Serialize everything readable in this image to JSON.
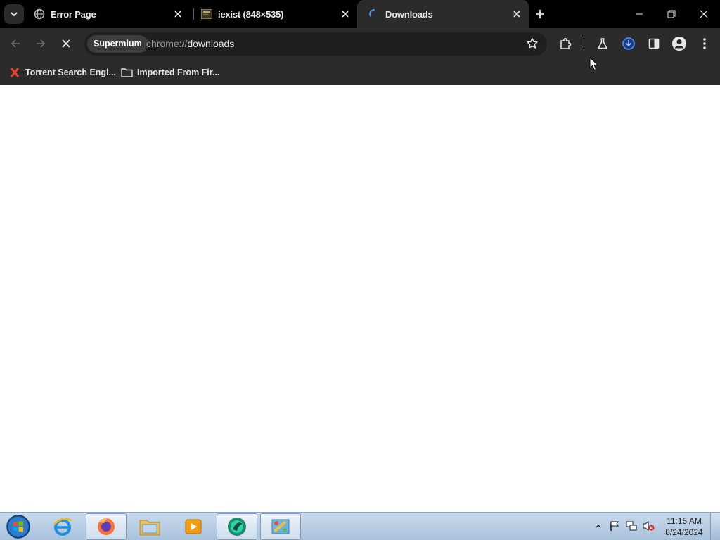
{
  "browser": {
    "tabs": [
      {
        "title": "Error Page",
        "icon": "globe-icon",
        "active": false
      },
      {
        "title": "iexist (848×535)",
        "icon": "image-icon",
        "active": false
      },
      {
        "title": "Downloads",
        "icon": "loading-icon",
        "active": true
      }
    ],
    "toolbar": {
      "site_chip": "Supermium",
      "url_scheme": "chrome://",
      "url_host": "downloads"
    },
    "bookmarks": [
      {
        "label": "Torrent Search Engi...",
        "icon": "x-logo-icon"
      },
      {
        "label": "Imported From Fir...",
        "icon": "folder-icon"
      }
    ]
  },
  "taskbar": {
    "items": [
      "internet-explorer-icon",
      "firefox-icon",
      "file-explorer-icon",
      "media-player-icon",
      "supermium-icon",
      "paint-icon"
    ],
    "clock": {
      "time": "11:15 AM",
      "date": "8/24/2024"
    }
  },
  "colors": {
    "tabstrip_bg": "#000000",
    "toolbar_bg": "#2b2b2b",
    "omnibox_bg": "#1f1f1f",
    "accent_blue": "#1a73e8",
    "taskbar_top": "#c9daec"
  }
}
